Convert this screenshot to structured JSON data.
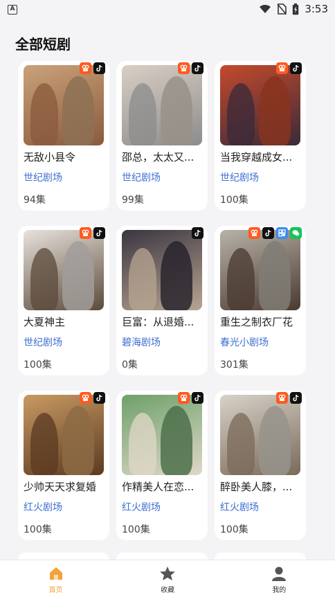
{
  "status_bar": {
    "time": "3:53",
    "app_icon_letter": "A"
  },
  "page": {
    "title": "全部短剧"
  },
  "dramas": [
    {
      "title": "无敌小县令",
      "channel": "世纪剧场",
      "episodes": "94集",
      "poster_caption": "",
      "badges": [
        "kuaishou-icon",
        "douyin-icon"
      ],
      "palette": [
        "#c9a27a",
        "#8a5a3c"
      ]
    },
    {
      "title": "邵总，太太又...",
      "channel": "世纪剧场",
      "episodes": "99集",
      "poster_caption": "",
      "badges": [
        "kuaishou-icon",
        "douyin-icon"
      ],
      "palette": [
        "#d9cfc4",
        "#8c8c8c"
      ]
    },
    {
      "title": "当我穿越成女...",
      "channel": "世纪剧场",
      "episodes": "100集",
      "poster_caption": "",
      "badges": [
        "kuaishou-icon",
        "douyin-icon"
      ],
      "palette": [
        "#c44a2c",
        "#3a2a3a"
      ]
    },
    {
      "title": "大夏神主",
      "channel": "世纪剧场",
      "episodes": "100集",
      "poster_caption": "",
      "badges": [
        "kuaishou-icon",
        "douyin-icon"
      ],
      "palette": [
        "#e8e2dc",
        "#5b4a3a"
      ]
    },
    {
      "title": "巨富：从退婚...",
      "channel": "碧海剧场",
      "episodes": "0集",
      "poster_caption": "",
      "badges": [
        "douyin-icon"
      ],
      "palette": [
        "#3a3540",
        "#b8a592"
      ]
    },
    {
      "title": "重生之制衣厂花",
      "channel": "春光小剧场",
      "episodes": "301集",
      "poster_caption": "",
      "badges": [
        "kuaishou-icon",
        "douyin-icon",
        "miniapp-icon",
        "wechat-icon"
      ],
      "palette": [
        "#b8b2a8",
        "#4a3a30"
      ]
    },
    {
      "title": "少帅天天求复婚",
      "channel": "红火剧场",
      "episodes": "100集",
      "poster_caption": "",
      "badges": [
        "kuaishou-icon",
        "douyin-icon"
      ],
      "palette": [
        "#c99a62",
        "#5a3a22"
      ]
    },
    {
      "title": "作精美人在恋...",
      "channel": "红火剧场",
      "episodes": "100集",
      "poster_caption": "",
      "badges": [
        "kuaishou-icon",
        "douyin-icon"
      ],
      "palette": [
        "#6ea06a",
        "#e0d8c8"
      ]
    },
    {
      "title": "醉卧美人膝，...",
      "channel": "红火剧场",
      "episodes": "100集",
      "poster_caption": "",
      "badges": [
        "kuaishou-icon",
        "douyin-icon"
      ],
      "palette": [
        "#d8d2c8",
        "#7a6a5a"
      ]
    }
  ],
  "bottom_nav": {
    "items": [
      {
        "label": "首页",
        "icon": "home-icon",
        "active": true
      },
      {
        "label": "收藏",
        "icon": "star-icon",
        "active": false
      },
      {
        "label": "我的",
        "icon": "profile-icon",
        "active": false
      }
    ]
  },
  "colors": {
    "accent": "#f2a33b",
    "channel": "#3d6fd1",
    "background": "#f4f4f6"
  }
}
